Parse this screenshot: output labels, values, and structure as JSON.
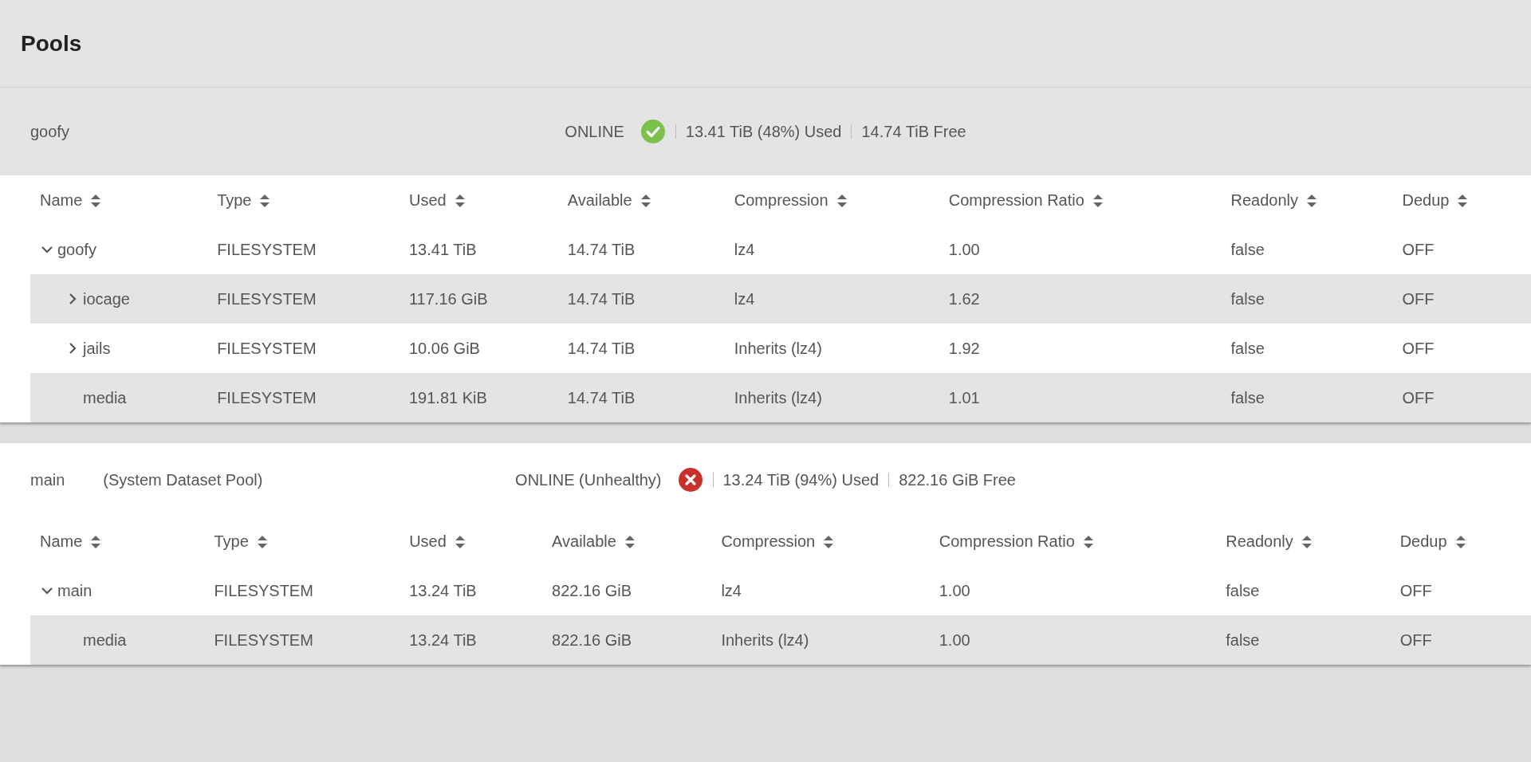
{
  "page_title": "Pools",
  "pools": [
    {
      "name": "goofy",
      "highlighted": true,
      "status": "ONLINE",
      "kind": "healthy",
      "used": "13.41 TiB (48%) Used",
      "free": "14.74 TiB Free",
      "columns": [
        "Name",
        "Type",
        "Used",
        "Available",
        "Compression",
        "Compression Ratio",
        "Readonly",
        "Dedup"
      ],
      "rows": [
        {
          "kind": "folder",
          "expanded": true,
          "cells": [
            "goofy",
            "FILESYSTEM",
            "13.41 TiB",
            "14.74 TiB",
            "lz4",
            "1.00",
            "false",
            "OFF"
          ],
          "children": [
            {
              "kind": "folder",
              "expanded": false,
              "cells": [
                "iocage",
                "FILESYSTEM",
                "117.16 GiB",
                "14.74 TiB",
                "lz4",
                "1.62",
                "false",
                "OFF"
              ]
            },
            {
              "kind": "folder",
              "expanded": false,
              "cells": [
                "jails",
                "FILESYSTEM",
                "10.06 GiB",
                "14.74 TiB",
                "Inherits (lz4)",
                "1.92",
                "false",
                "OFF"
              ]
            },
            {
              "kind": "leaf",
              "cells": [
                "media",
                "FILESYSTEM",
                "191.81 KiB",
                "14.74 TiB",
                "Inherits (lz4)",
                "1.01",
                "false",
                "OFF"
              ]
            }
          ]
        }
      ]
    },
    {
      "name": "main",
      "note": "(System Dataset Pool)",
      "highlighted": false,
      "status": "ONLINE (Unhealthy)",
      "kind": "unhealthy",
      "used": "13.24 TiB (94%) Used",
      "free": "822.16 GiB Free",
      "columns": [
        "Name",
        "Type",
        "Used",
        "Available",
        "Compression",
        "Compression Ratio",
        "Readonly",
        "Dedup"
      ],
      "rows": [
        {
          "kind": "folder",
          "expanded": true,
          "cells": [
            "main",
            "FILESYSTEM",
            "13.24 TiB",
            "822.16 GiB",
            "lz4",
            "1.00",
            "false",
            "OFF"
          ],
          "children": [
            {
              "kind": "leaf",
              "cells": [
                "media",
                "FILESYSTEM",
                "13.24 TiB",
                "822.16 GiB",
                "Inherits (lz4)",
                "1.00",
                "false",
                "OFF"
              ]
            }
          ]
        }
      ]
    }
  ]
}
